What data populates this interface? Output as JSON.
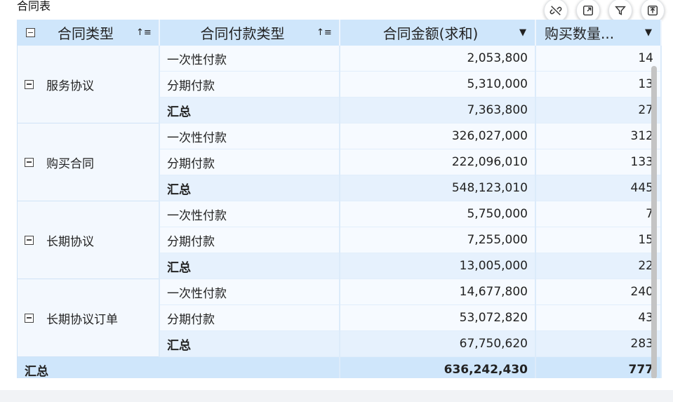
{
  "title": "合同表",
  "toolbar": {
    "icons": [
      "unlink-icon",
      "expand-icon",
      "filter-icon",
      "export-icon"
    ]
  },
  "columns": [
    {
      "label": "合同类型",
      "icon": "sort-icon"
    },
    {
      "label": "合同付款类型",
      "icon": "sort-icon"
    },
    {
      "label": "合同金额(求和)",
      "icon": "dropdown-icon"
    },
    {
      "label": "购买数量...",
      "icon": "dropdown-icon"
    }
  ],
  "groups": [
    {
      "name": "服务协议",
      "rows": [
        {
          "type": "一次性付款",
          "amount": "2,053,800",
          "qty": "14"
        },
        {
          "type": "分期付款",
          "amount": "5,310,000",
          "qty": "13"
        },
        {
          "type": "汇总",
          "amount": "7,363,800",
          "qty": "27"
        }
      ]
    },
    {
      "name": "购买合同",
      "rows": [
        {
          "type": "一次性付款",
          "amount": "326,027,000",
          "qty": "312"
        },
        {
          "type": "分期付款",
          "amount": "222,096,010",
          "qty": "133"
        },
        {
          "type": "汇总",
          "amount": "548,123,010",
          "qty": "445"
        }
      ]
    },
    {
      "name": "长期协议",
      "rows": [
        {
          "type": "一次性付款",
          "amount": "5,750,000",
          "qty": "7"
        },
        {
          "type": "分期付款",
          "amount": "7,255,000",
          "qty": "15"
        },
        {
          "type": "汇总",
          "amount": "13,005,000",
          "qty": "22"
        }
      ]
    },
    {
      "name": "长期协议订单",
      "rows": [
        {
          "type": "一次性付款",
          "amount": "14,677,800",
          "qty": "240"
        },
        {
          "type": "分期付款",
          "amount": "53,072,820",
          "qty": "43"
        },
        {
          "type": "汇总",
          "amount": "67,750,620",
          "qty": "283"
        }
      ]
    }
  ],
  "grand_total": {
    "label": "汇总",
    "amount": "636,242,430",
    "qty": "777"
  }
}
